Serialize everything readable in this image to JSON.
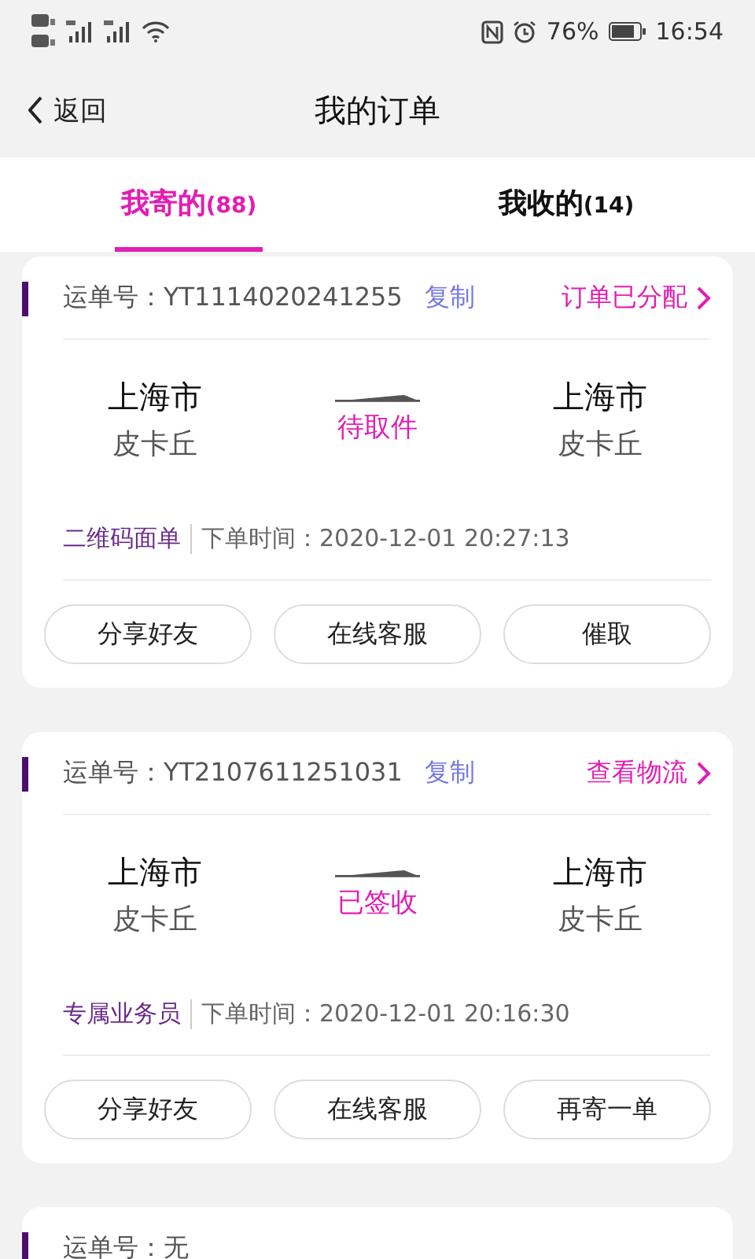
{
  "status_bar": {
    "battery": "76%",
    "time": "16:54"
  },
  "header": {
    "back": "返回",
    "title": "我的订单"
  },
  "tabs": [
    {
      "label": "我寄的",
      "count": "(88)",
      "selected": true
    },
    {
      "label": "我收的",
      "count": "(14)",
      "selected": false
    }
  ],
  "orders": [
    {
      "waybill_label": "运单号：",
      "waybill": "YT1114020241255",
      "copy": "复制",
      "status_link": "订单已分配",
      "from": {
        "city": "上海市",
        "district": "皮卡丘"
      },
      "state": "待取件",
      "to": {
        "city": "上海市",
        "district": "皮卡丘"
      },
      "tag": "二维码面单",
      "time": "下单时间：2020-12-01 20:27:13",
      "buttons": [
        "分享好友",
        "在线客服",
        "催取"
      ]
    },
    {
      "waybill_label": "运单号：",
      "waybill": "YT2107611251031",
      "copy": "复制",
      "status_link": "查看物流",
      "from": {
        "city": "上海市",
        "district": "皮卡丘"
      },
      "state": "已签收",
      "to": {
        "city": "上海市",
        "district": "皮卡丘"
      },
      "tag": "专属业务员",
      "time": "下单时间：2020-12-01 20:16:30",
      "buttons": [
        "分享好友",
        "在线客服",
        "再寄一单"
      ]
    },
    {
      "waybill_label": "运单号：",
      "waybill": "无"
    }
  ]
}
